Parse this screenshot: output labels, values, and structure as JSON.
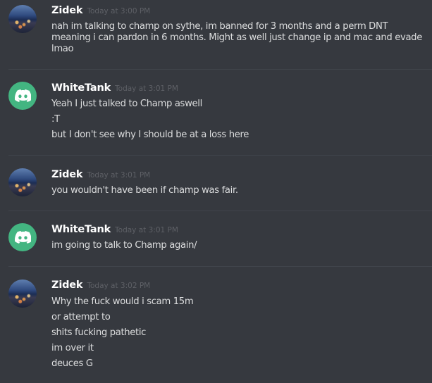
{
  "messages": [
    {
      "author": "Zidek",
      "timestamp": "Today at 3:00 PM",
      "avatar": "city-night-photo",
      "lines": [
        "nah im talking to champ on sythe, im banned for 3 months and a perm DNT",
        "meaning i can pardon in 6 months. Might as well just change ip and mac and evade",
        "lmao"
      ]
    },
    {
      "author": "WhiteTank",
      "timestamp": "Today at 3:01 PM",
      "avatar": "discord-default-icon",
      "lines": [
        "Yeah I just talked to Champ aswell",
        ":T",
        "but I don't see why I should be at a loss here"
      ]
    },
    {
      "author": "Zidek",
      "timestamp": "Today at 3:01 PM",
      "avatar": "city-night-photo",
      "lines": [
        "you wouldn't have been if champ was fair."
      ]
    },
    {
      "author": "WhiteTank",
      "timestamp": "Today at 3:01 PM",
      "avatar": "discord-default-icon",
      "lines": [
        "im going to talk to Champ again/"
      ]
    },
    {
      "author": "Zidek",
      "timestamp": "Today at 3:02 PM",
      "avatar": "city-night-photo",
      "lines": [
        "Why the fuck would i scam 15m",
        "or attempt to",
        "shits fucking pathetic",
        "im over it",
        "deuces G"
      ]
    }
  ],
  "colors": {
    "background": "#36393f",
    "username": "#ffffff",
    "message_text": "#dcddde",
    "timestamp": "#5e6066",
    "divider": "#40444b",
    "discord_avatar_bg": "#43b581"
  }
}
